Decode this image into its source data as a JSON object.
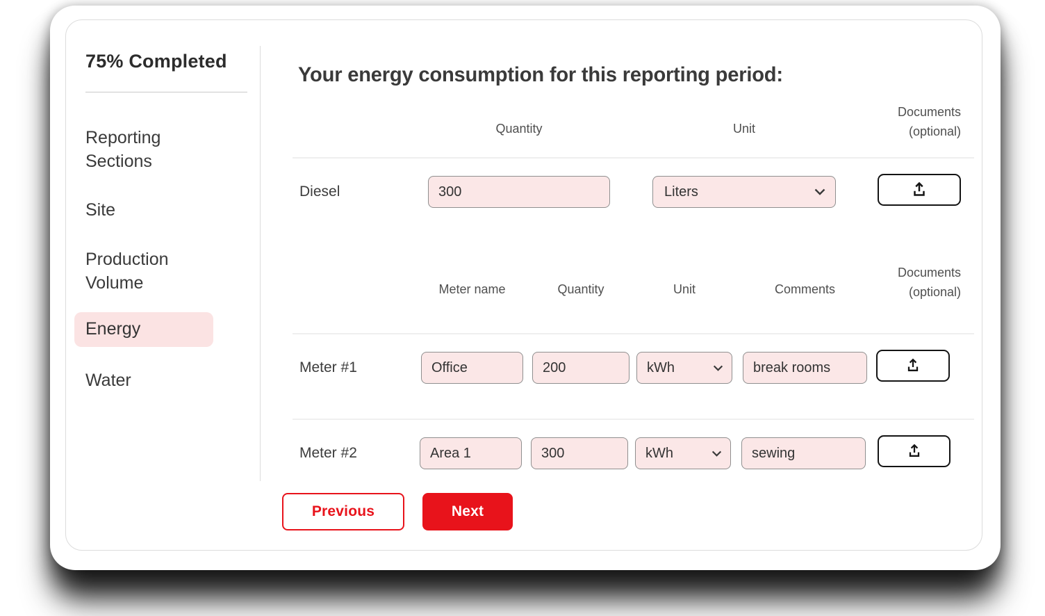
{
  "sidebar": {
    "progress_label": "75% Completed",
    "items": [
      {
        "label": "Reporting Sections",
        "active": false
      },
      {
        "label": "Site",
        "active": false
      },
      {
        "label": "Production Volume",
        "active": false
      },
      {
        "label": "Energy",
        "active": true
      },
      {
        "label": "Water",
        "active": false
      }
    ]
  },
  "main": {
    "title": "Your energy consumption for this reporting period:",
    "fuel_table": {
      "headers": {
        "quantity": "Quantity",
        "unit": "Unit",
        "documents_line1": "Documents",
        "documents_line2": "(optional)"
      },
      "rows": [
        {
          "label": "Diesel",
          "quantity": "300",
          "unit": "Liters",
          "upload_icon": "upload-icon"
        }
      ]
    },
    "meter_table": {
      "headers": {
        "meter_name": "Meter name",
        "quantity": "Quantity",
        "unit": "Unit",
        "comments": "Comments",
        "documents_line1": "Documents",
        "documents_line2": "(optional)"
      },
      "rows": [
        {
          "label": "Meter #1",
          "meter_name": "Office",
          "quantity": "200",
          "unit": "kWh",
          "comments": "break rooms",
          "upload_icon": "upload-icon"
        },
        {
          "label": "Meter #2",
          "meter_name": "Area 1",
          "quantity": "300",
          "unit": "kWh",
          "comments": "sewing",
          "upload_icon": "upload-icon"
        }
      ]
    },
    "buttons": {
      "previous": "Previous",
      "next": "Next"
    }
  },
  "icons": {
    "upload": "upload-icon",
    "chevron": "chevron-down-icon"
  },
  "colors": {
    "accent_red": "#e8131b",
    "pink_fill": "#fbe7e7",
    "highlight_pink": "#fbe3e3",
    "text_dark": "#333333",
    "text_mid": "#4f4f4f"
  }
}
